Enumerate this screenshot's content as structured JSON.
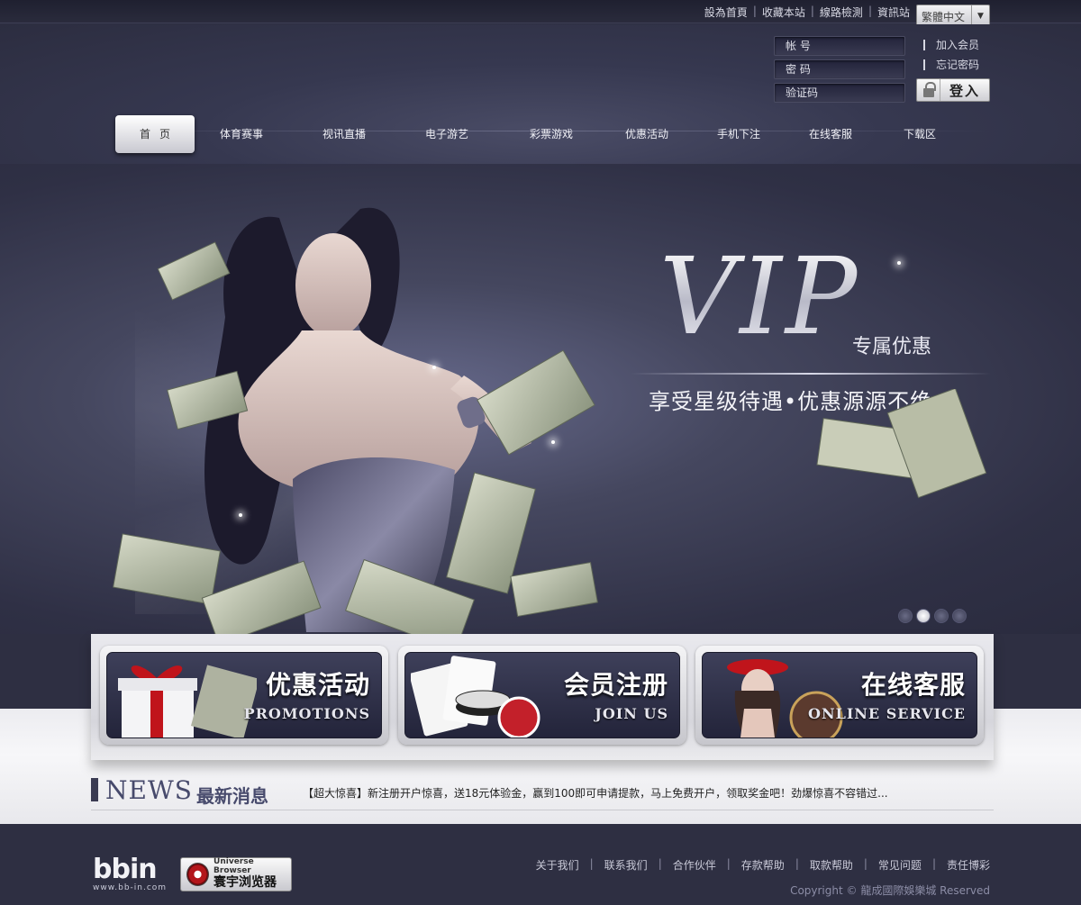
{
  "top_links": [
    "設為首頁",
    "收藏本站",
    "線路檢測",
    "資訊站"
  ],
  "language": "繁體中文",
  "login": {
    "account_placeholder": "帐 号",
    "password_placeholder": "密 码",
    "captcha_placeholder": "验证码",
    "join_link": "加入会员",
    "forgot_link": "忘记密码",
    "login_button": "登入"
  },
  "nav": [
    "首页",
    "体育赛事",
    "视讯直播",
    "电子游艺",
    "彩票游戏",
    "优惠活动",
    "手机下注",
    "在线客服",
    "下载区"
  ],
  "banner": {
    "title": "VIP",
    "subtitle": "专属优惠",
    "tagline": "享受星级待遇•优惠源源不绝",
    "slides": 4,
    "active_slide": 2
  },
  "promos": [
    {
      "title": "优惠活动",
      "subtitle": "PROMOTIONS"
    },
    {
      "title": "会员注册",
      "subtitle": "JOIN US"
    },
    {
      "title": "在线客服",
      "subtitle": "ONLINE SERVICE"
    }
  ],
  "news": {
    "title_en": "NEWS",
    "title_cn": "最新消息",
    "text": "【超大惊喜】新注册开户惊喜，送18元体验金，赢到100即可申请提款，马上免费开户，领取奖金吧！劲爆惊喜不容错过..."
  },
  "footer": {
    "logo_text": "bbin",
    "logo_url": "www.bb-in.com",
    "browser_en": "Universe Browser",
    "browser_cn": "寰宇浏览器",
    "links": [
      "关于我们",
      "联系我们",
      "合作伙伴",
      "存款帮助",
      "取款帮助",
      "常见问题",
      "责任博彩"
    ],
    "copyright": "Copyright © 龍成國際娛樂城 Reserved"
  },
  "colors": {
    "page_bg": "#2e2f42",
    "accent": "#474a6c",
    "light_band": "#ececf0"
  }
}
